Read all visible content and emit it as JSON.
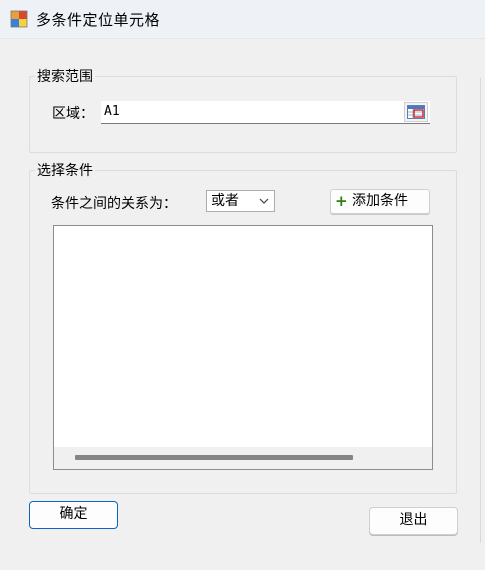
{
  "window": {
    "title": "多条件定位单元格"
  },
  "search": {
    "group_title": "搜索范围",
    "area_label": "区域：",
    "area_value": "A1"
  },
  "conditions": {
    "group_title": "选择条件",
    "relation_label": "条件之间的关系为：",
    "relation_selected": "或者",
    "add_label": "添加条件"
  },
  "footer": {
    "ok_label": "确定",
    "exit_label": "退出"
  },
  "colors": {
    "accent": "#0a64c8",
    "plus": "#2f7d12"
  }
}
